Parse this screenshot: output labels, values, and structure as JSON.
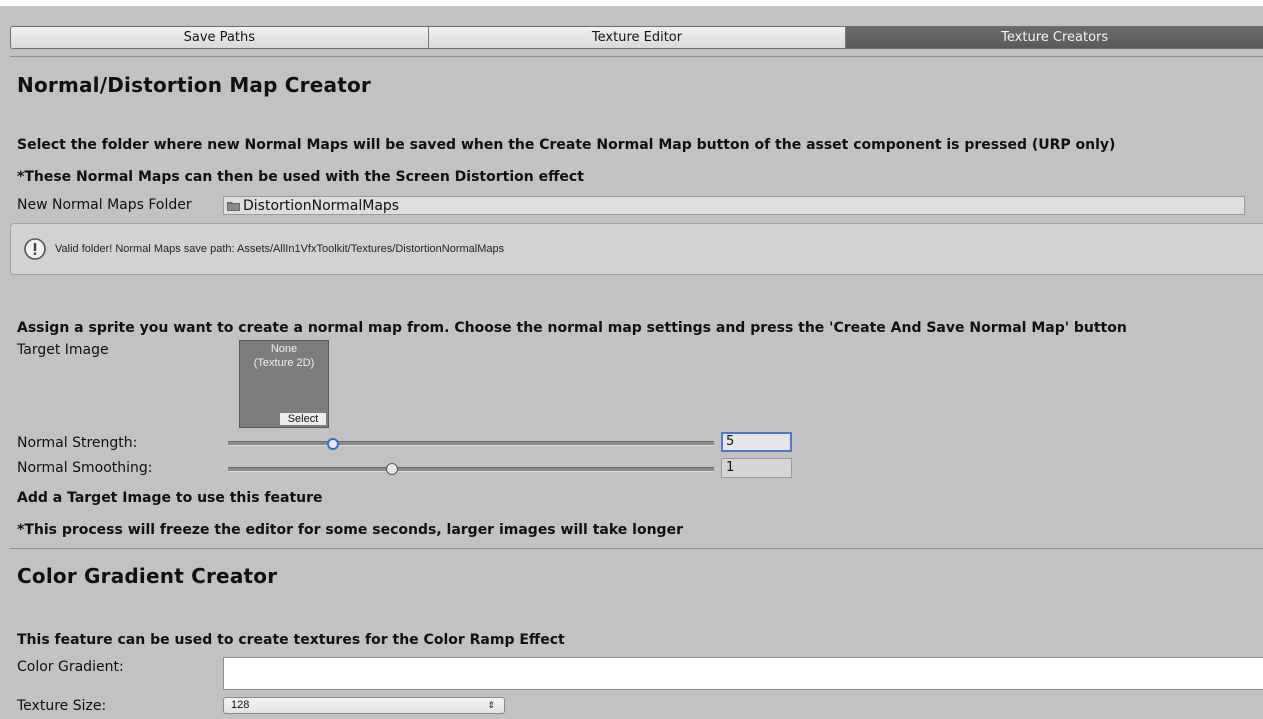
{
  "tabs": [
    {
      "label": "Save Paths",
      "active": false
    },
    {
      "label": "Texture Editor",
      "active": false
    },
    {
      "label": "Texture Creators",
      "active": true
    }
  ],
  "normal_section": {
    "title": "Normal/Distortion Map Creator",
    "folder_instruction": "Select the folder where new Normal Maps will be saved when the Create Normal Map button of the asset component is pressed (URP only)",
    "folder_note": "*These Normal Maps can then be used with the Screen Distortion effect",
    "folder_label": "New Normal Maps Folder",
    "folder_value": "DistortionNormalMaps",
    "help_message": "Valid folder! Normal Maps save path: Assets/AllIn1VfxToolkit/Textures/DistortionNormalMaps",
    "assign_instruction": "Assign a sprite you want to create a normal map from. Choose the normal map settings and press the 'Create And Save Normal Map' button",
    "target_image_label": "Target Image",
    "target_image_value_line1": "None",
    "target_image_value_line2": "(Texture 2D)",
    "select_button": "Select",
    "strength_label": "Normal Strength:",
    "strength_value": "5",
    "smoothing_label": "Normal Smoothing:",
    "smoothing_value": "1",
    "warning": "Add a Target Image to use this feature",
    "freeze_note": "*This process will freeze the editor for some seconds, larger images will take longer"
  },
  "gradient_section": {
    "title": "Color Gradient Creator",
    "instruction": "This feature can be used to create textures for the Color Ramp Effect",
    "gradient_label": "Color Gradient:",
    "texture_size_label": "Texture Size:",
    "texture_size_value": "128"
  },
  "icons": {
    "folder": "folder-icon",
    "info": "info-icon",
    "dropdown": "dropdown-arrow-icon"
  },
  "colors": {
    "background": "#c2c2c2",
    "active_tab": "#5f5f5f",
    "focus_accent": "#4f77d8"
  }
}
